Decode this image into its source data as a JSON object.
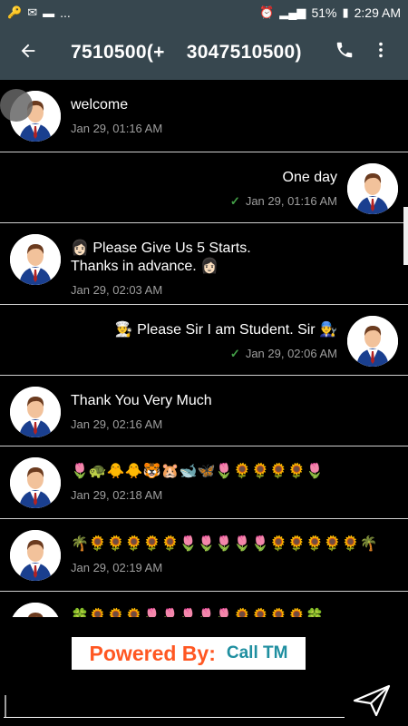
{
  "status": {
    "left_icons": [
      "key-icon",
      "lock-message-icon",
      "folder-icon",
      "more-notifications-icon"
    ],
    "more": "...",
    "battery": "51%",
    "time": "2:29 AM"
  },
  "header": {
    "title_a": "7510500(+",
    "title_b": "3047510500)"
  },
  "messages": [
    {
      "dir": "in",
      "text": "welcome",
      "time": "Jan 29, 01:16 AM"
    },
    {
      "dir": "out",
      "text": "One day",
      "time": "Jan 29, 01:16 AM",
      "check": "✓"
    },
    {
      "dir": "in",
      "text": "👩🏻 Please Give Us 5 Starts.\nThanks in advance. 👩🏻",
      "time": "Jan 29, 02:03 AM"
    },
    {
      "dir": "out",
      "text": "👨‍🍳 Please Sir I am Student. Sir 👨‍🔧",
      "time": "Jan 29, 02:06 AM",
      "check": "✓"
    },
    {
      "dir": "in",
      "text": " Thank You Very Much",
      "time": "Jan 29, 02:16 AM"
    },
    {
      "dir": "in",
      "text": "🌷🐢🐥🐥🐯🐹🐋🦋🌷🌻🌻🌻🌻🌷",
      "time": "Jan 29, 02:18 AM"
    },
    {
      "dir": "in",
      "text": "🌴🌻🌻🌻🌻🌻🌷🌷🌷🌷🌷🌻🌻🌻🌻🌻🌴",
      "time": "Jan 29, 02:19 AM"
    },
    {
      "dir": "in",
      "text": "🍀🌻🌻🌻🌷🌷🌷🌷🌷🌻🌻🌻🌻🍀",
      "time": ""
    }
  ],
  "banner": {
    "powered": "Powered By:",
    "call": "Call TM"
  },
  "icons": {
    "back": "back-arrow-icon",
    "phone": "phone-icon",
    "menu": "more-vert-icon",
    "send": "send-icon"
  }
}
